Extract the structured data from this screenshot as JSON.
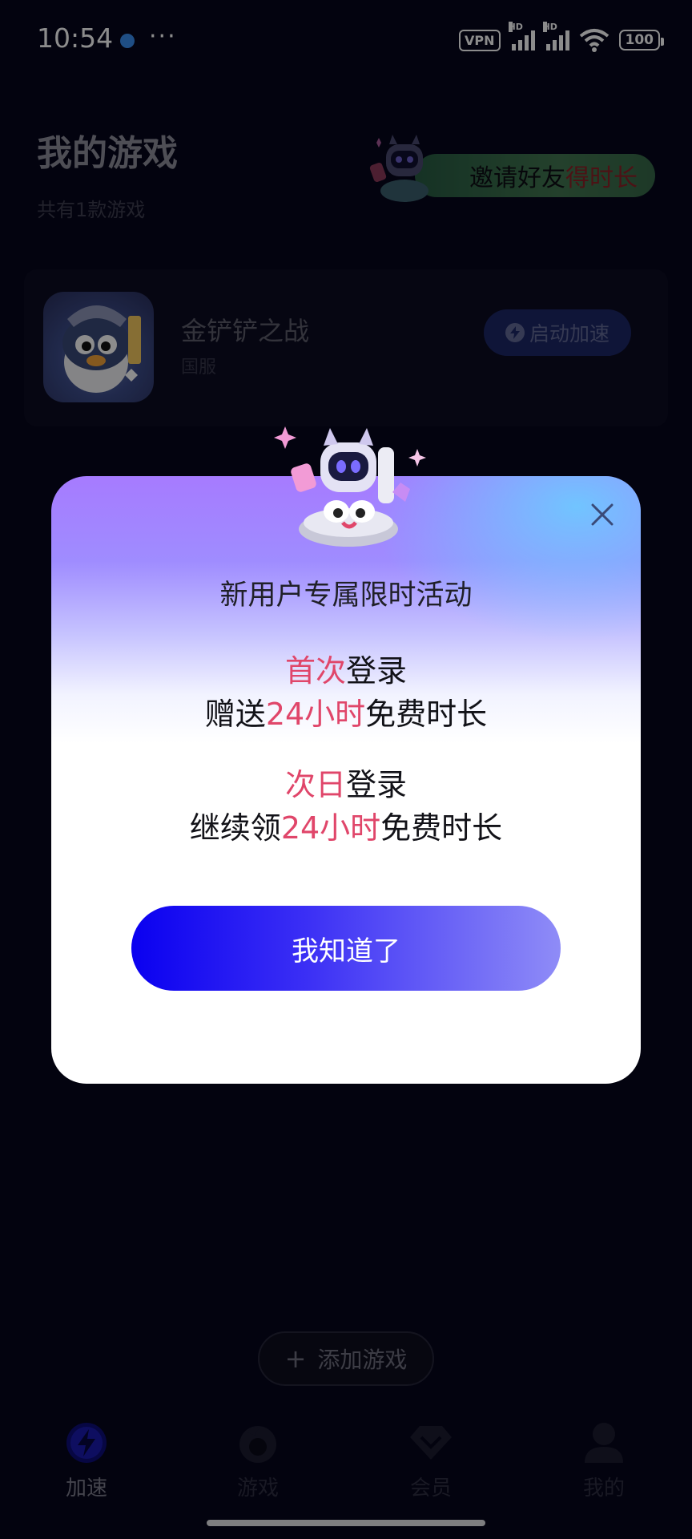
{
  "status_bar": {
    "time": "10:54",
    "more": "···",
    "vpn": "VPN",
    "hd": "HD",
    "battery": "100"
  },
  "header": {
    "title": "我的游戏",
    "subtitle": "共有1款游戏",
    "invite": {
      "text_main": "邀请好友",
      "text_highlight": "得时长"
    }
  },
  "games": [
    {
      "name": "金铲铲之战",
      "region": "国服",
      "boost_label": "启动加速"
    }
  ],
  "add_game_label": "添加游戏",
  "bottom_nav": [
    {
      "label": "加速",
      "icon": "bolt-icon",
      "active": true
    },
    {
      "label": "游戏",
      "icon": "game-icon",
      "active": false
    },
    {
      "label": "会员",
      "icon": "diamond-icon",
      "active": false
    },
    {
      "label": "我的",
      "icon": "profile-icon",
      "active": false
    }
  ],
  "modal": {
    "title": "新用户专属限时活动",
    "first_login": {
      "highlight": "首次",
      "rest": "登录"
    },
    "first_gift": {
      "prefix": "赠送",
      "highlight": "24小时",
      "suffix": "免费时长"
    },
    "next_login": {
      "highlight": "次日",
      "rest": "登录"
    },
    "next_gift": {
      "prefix": "继续领",
      "highlight": "24小时",
      "suffix": "免费时长"
    },
    "confirm_label": "我知道了"
  },
  "colors": {
    "highlight": "#e0466a",
    "button_start": "#0a00f0",
    "button_end": "#8f8cf7",
    "background": "#06061c"
  }
}
